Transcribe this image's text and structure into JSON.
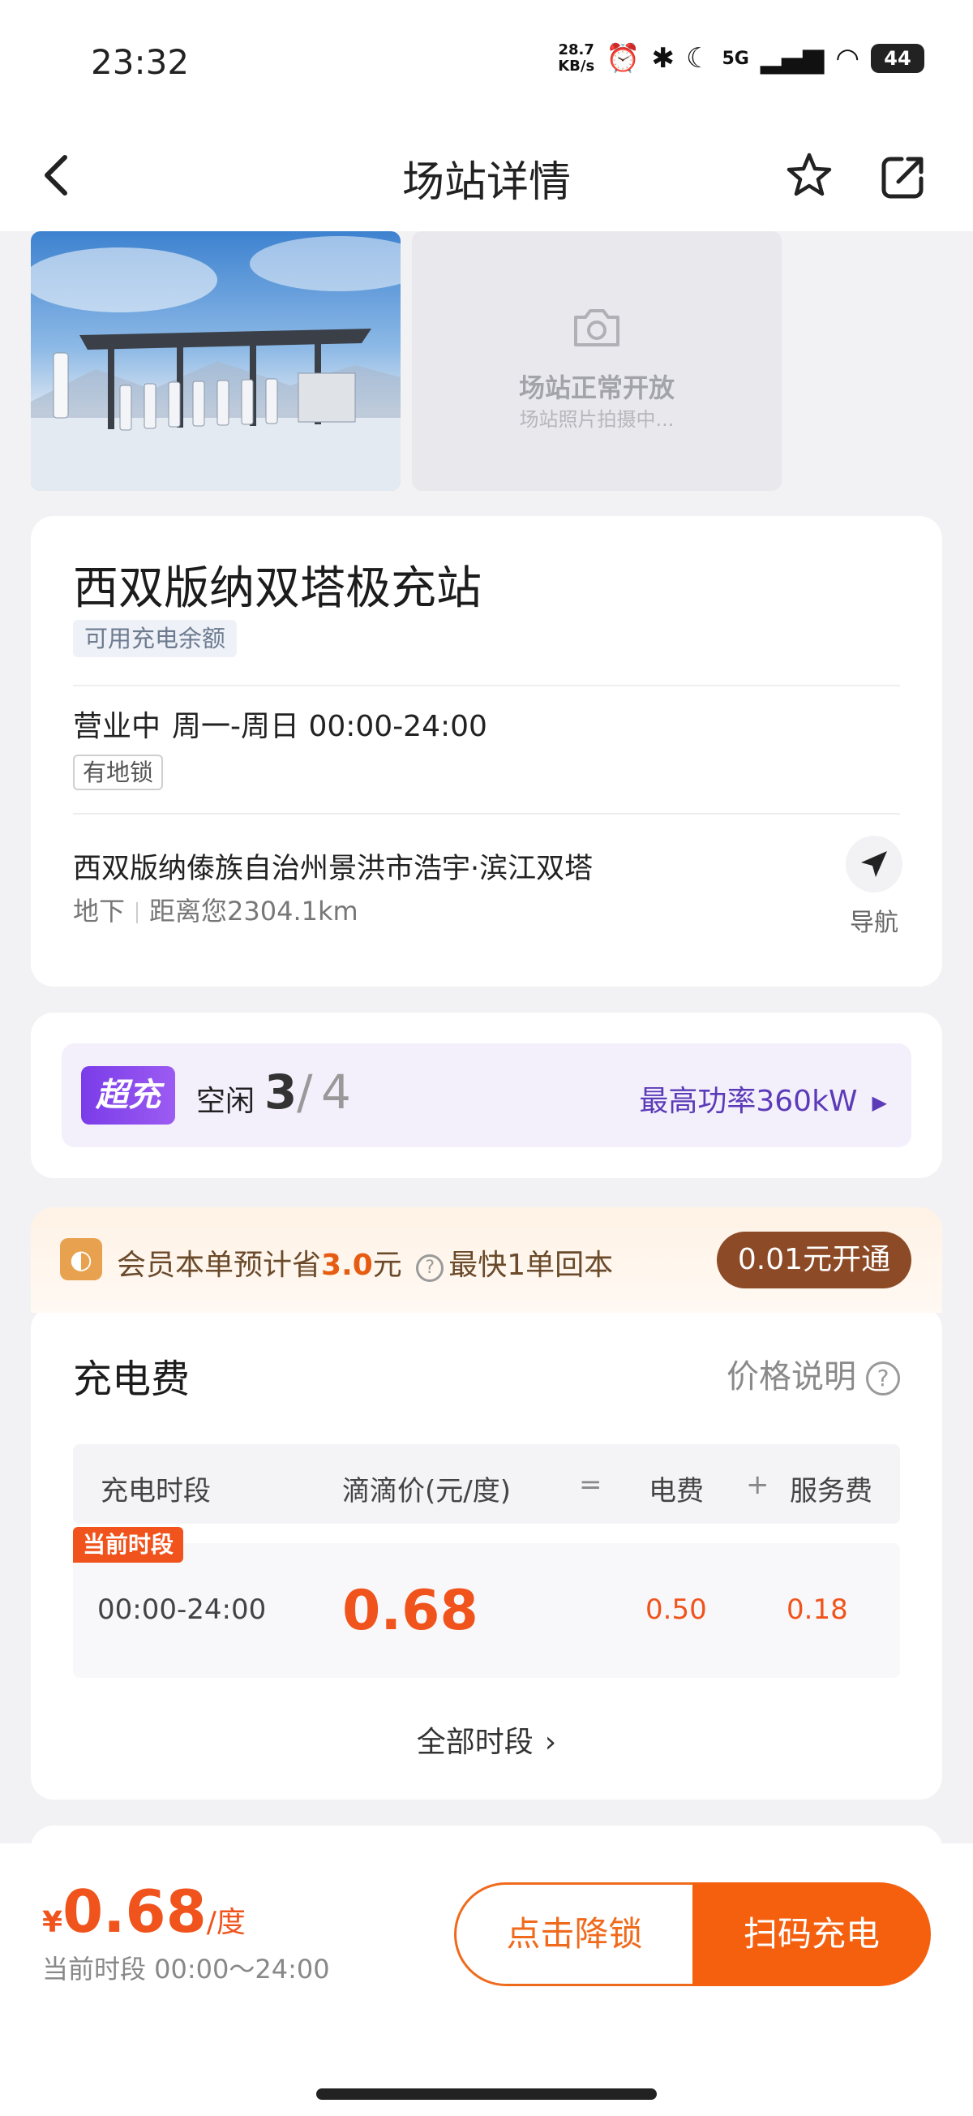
{
  "status_bar": {
    "time": "23:32",
    "net_speed_value": "28.7",
    "net_speed_unit": "KB/s",
    "signal_label": "5G",
    "battery": "44"
  },
  "nav": {
    "title": "场站详情",
    "back_icon": "chevron-left-icon",
    "favorite_icon": "star-icon",
    "share_icon": "share-icon"
  },
  "photos": {
    "placeholder_title": "场站正常开放",
    "placeholder_subtitle": "场站照片拍摄中..."
  },
  "station": {
    "name": "西双版纳双塔极充站",
    "balance_tag": "可用充电余额",
    "status": "营业中",
    "days_hours": "周一-周日 00:00-24:00",
    "lock_tag": "有地锁",
    "address": "西双版纳傣族自治州景洪市浩宇·滨江双塔",
    "floor": "地下",
    "distance": "距离您2304.1km",
    "navigate_label": "导航"
  },
  "charger": {
    "badge": "超充",
    "idle_label": "空闲",
    "idle_count": "3",
    "separator": "/",
    "total_count": "4",
    "max_power": "最高功率360kW"
  },
  "member": {
    "prefix": "会员本单预计省",
    "amount": "3.0",
    "suffix": "元",
    "payback": "最快1单回本",
    "button": "0.01元开通",
    "accent": "#8c4a26"
  },
  "fee": {
    "title": "充电费",
    "price_explain": "价格说明",
    "headers": {
      "period": "充电时段",
      "didi_price": "滴滴价(元/度)",
      "equals": "=",
      "electricity": "电费",
      "plus": "+",
      "service": "服务费"
    },
    "current_tag": "当前时段",
    "row": {
      "period": "00:00-24:00",
      "price": "0.68",
      "electricity": "0.50",
      "service": "0.18"
    },
    "all_periods": "全部时段"
  },
  "bottom": {
    "currency": "¥",
    "price": "0.68",
    "unit": "/度",
    "period": "当前时段 00:00～24:00",
    "unlock_button": "点击降锁",
    "scan_button": "扫码充电",
    "accent": "#f0531c"
  }
}
